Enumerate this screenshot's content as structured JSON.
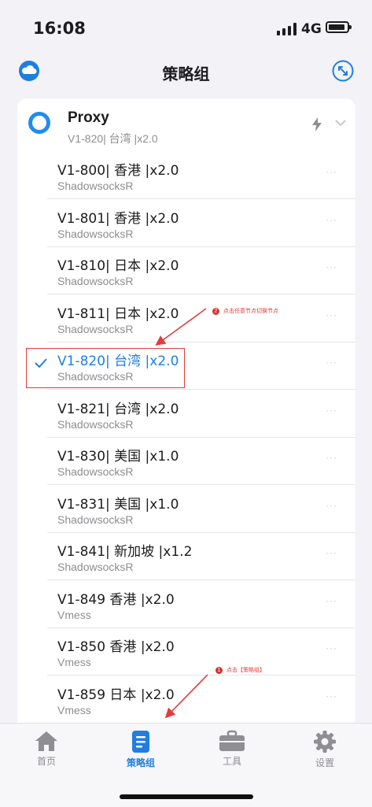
{
  "status_bar": {
    "time": "16:08",
    "network": "4G"
  },
  "nav": {
    "title": "策略组",
    "left_icon": "cloud-icon",
    "right_icon": "expand-arrows-icon"
  },
  "group": {
    "name": "Proxy",
    "selected": "V1-820| 台湾 |x2.0",
    "icons": [
      "bolt-icon",
      "chevron-down-icon"
    ]
  },
  "nodes": [
    {
      "name": "V1-800| 香港 |x2.0",
      "type": "ShadowsocksR",
      "selected": false
    },
    {
      "name": "V1-801| 香港 |x2.0",
      "type": "ShadowsocksR",
      "selected": false
    },
    {
      "name": "V1-810| 日本 |x2.0",
      "type": "ShadowsocksR",
      "selected": false
    },
    {
      "name": "V1-811| 日本 |x2.0",
      "type": "ShadowsocksR",
      "selected": false
    },
    {
      "name": "V1-820| 台湾 |x2.0",
      "type": "ShadowsocksR",
      "selected": true
    },
    {
      "name": "V1-821| 台湾 |x2.0",
      "type": "ShadowsocksR",
      "selected": false
    },
    {
      "name": "V1-830| 美国 |x1.0",
      "type": "ShadowsocksR",
      "selected": false
    },
    {
      "name": "V1-831| 美国 |x1.0",
      "type": "ShadowsocksR",
      "selected": false
    },
    {
      "name": "V1-841| 新加坡 |x1.2",
      "type": "ShadowsocksR",
      "selected": false
    },
    {
      "name": "V1-849 香港 |x2.0",
      "type": "Vmess",
      "selected": false
    },
    {
      "name": "V1-850 香港 |x2.0",
      "type": "Vmess",
      "selected": false
    },
    {
      "name": "V1-859 日本 |x2.0",
      "type": "Vmess",
      "selected": false
    }
  ],
  "more_label": "···",
  "annotations": [
    {
      "num": "2",
      "text": "点击任意节点切换节点"
    },
    {
      "num": "1",
      "text": "点击【策略组】"
    }
  ],
  "tabs": [
    {
      "label": "首页",
      "icon": "home-icon",
      "active": false
    },
    {
      "label": "策略组",
      "icon": "document-icon",
      "active": true
    },
    {
      "label": "工具",
      "icon": "toolbox-icon",
      "active": false
    },
    {
      "label": "设置",
      "icon": "gear-icon",
      "active": false
    }
  ],
  "colors": {
    "accent": "#1f7fe0",
    "annotation": "#e23c3c",
    "background": "#f2f2f7"
  }
}
